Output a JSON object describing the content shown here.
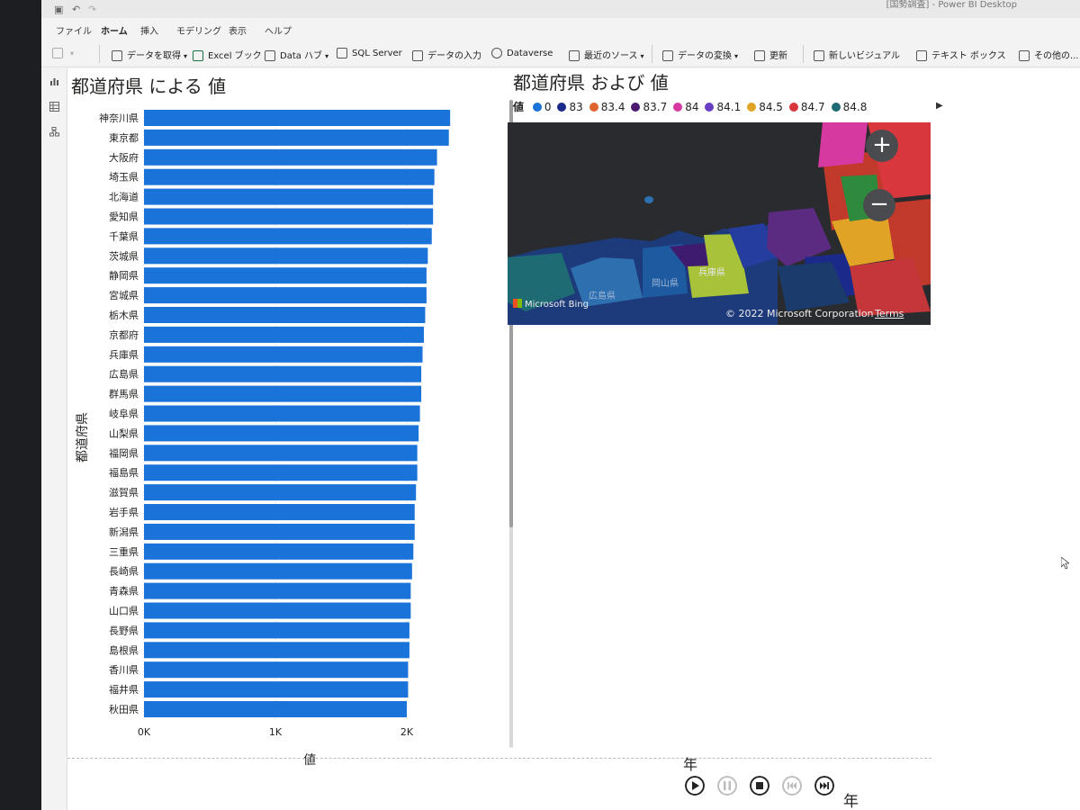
{
  "app": {
    "title": "[国勢調査] - Power BI Desktop"
  },
  "menubar": {
    "items": [
      {
        "label": "ファイル"
      },
      {
        "label": "ホーム"
      },
      {
        "label": "挿入"
      },
      {
        "label": "モデリング"
      },
      {
        "label": "表示"
      },
      {
        "label": "ヘルプ"
      }
    ],
    "active": "ホーム"
  },
  "ribbon": {
    "get_data": "データを取得",
    "excel": "Excel ブック",
    "data_hub": "Data ハブ",
    "sql": "SQL Server",
    "enter_data": "データの入力",
    "dataverse": "Dataverse",
    "recent_sources": "最近のソース",
    "transform": "データの変換",
    "refresh": "更新",
    "new_visual": "新しいビジュアル",
    "text_box": "テキスト ボックス",
    "more_visuals": "その他の..."
  },
  "sidebar": {
    "items": [
      {
        "icon": "report-view-icon"
      },
      {
        "icon": "data-view-icon"
      },
      {
        "icon": "model-view-icon"
      }
    ]
  },
  "bar_visual": {
    "title": "都道府県 による 値",
    "ylabel": "都道府県",
    "xlabel": "値"
  },
  "chart_data": {
    "type": "bar",
    "orientation": "horizontal",
    "title": "都道府県 による 値",
    "xlabel": "値",
    "ylabel": "都道府県",
    "xlim": [
      0,
      2000
    ],
    "xticks": [
      "0K",
      "1K",
      "2K"
    ],
    "color": "#1a73d9",
    "categories": [
      "神奈川県",
      "東京都",
      "大阪府",
      "埼玉県",
      "北海道",
      "愛知県",
      "千葉県",
      "茨城県",
      "静岡県",
      "宮城県",
      "栃木県",
      "京都府",
      "兵庫県",
      "広島県",
      "群馬県",
      "岐阜県",
      "山梨県",
      "福岡県",
      "福島県",
      "滋賀県",
      "岩手県",
      "新潟県",
      "三重県",
      "長崎県",
      "青森県",
      "山口県",
      "長野県",
      "島根県",
      "香川県",
      "福井県",
      "秋田県"
    ],
    "values": [
      2330,
      2320,
      2230,
      2210,
      2200,
      2200,
      2190,
      2160,
      2150,
      2150,
      2140,
      2130,
      2120,
      2110,
      2110,
      2100,
      2090,
      2080,
      2080,
      2070,
      2060,
      2060,
      2050,
      2040,
      2030,
      2030,
      2020,
      2020,
      2010,
      2010,
      2000
    ]
  },
  "map_visual": {
    "title": "都道府県 および 値",
    "legend_title": "値",
    "legend": [
      {
        "label": "0",
        "color": "#1a73d9"
      },
      {
        "label": "83",
        "color": "#1b2a8a"
      },
      {
        "label": "83.4",
        "color": "#e0632d"
      },
      {
        "label": "83.7",
        "color": "#4b1a6e"
      },
      {
        "label": "84",
        "color": "#d63aa0"
      },
      {
        "label": "84.1",
        "color": "#6a3fc4"
      },
      {
        "label": "84.5",
        "color": "#e0a326"
      },
      {
        "label": "84.7",
        "color": "#d9373e"
      },
      {
        "label": "84.8",
        "color": "#1f6b73"
      }
    ],
    "zoom_in": "+",
    "zoom_out": "−",
    "bing_label": "Microsoft Bing",
    "copyright": "© 2022 Microsoft Corporation",
    "terms": "Terms",
    "map_labels": {
      "hyogo": "兵庫県",
      "okayama": "岡山県",
      "hiroshima": "広島県"
    }
  },
  "play_axis": {
    "title": "年",
    "current_label": "年"
  }
}
